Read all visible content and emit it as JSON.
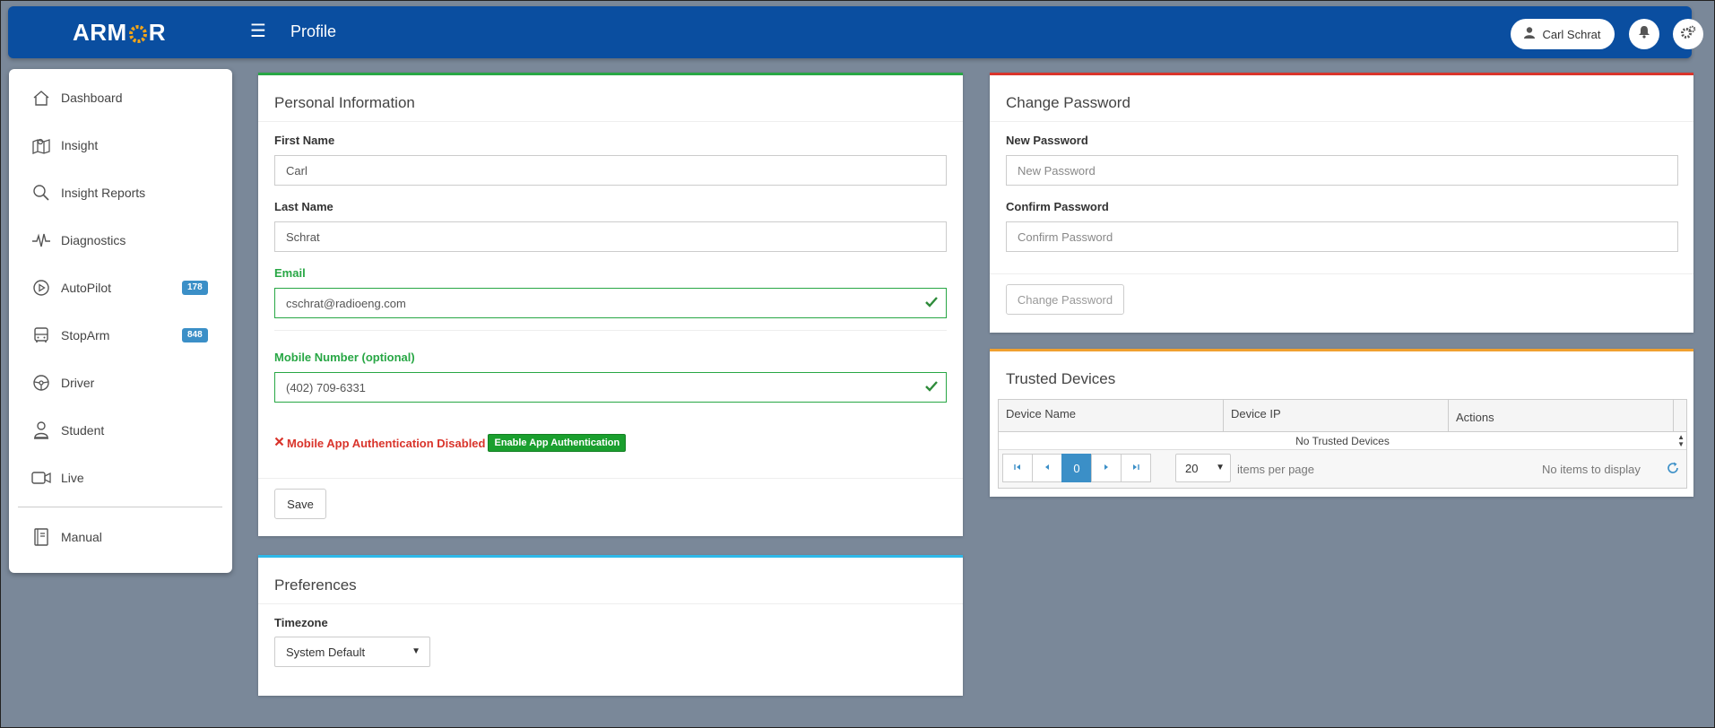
{
  "header": {
    "logo": "ARMOR",
    "page_title": "Profile",
    "user_name": "Carl Schrat"
  },
  "sidebar": {
    "items": [
      {
        "label": "Dashboard",
        "icon": "home-icon"
      },
      {
        "label": "Insight",
        "icon": "map-icon"
      },
      {
        "label": "Insight Reports",
        "icon": "search-icon"
      },
      {
        "label": "Diagnostics",
        "icon": "pulse-icon"
      },
      {
        "label": "AutoPilot",
        "icon": "play-circle-icon",
        "badge": "178"
      },
      {
        "label": "StopArm",
        "icon": "bus-icon",
        "badge": "848"
      },
      {
        "label": "Driver",
        "icon": "steering-wheel-icon"
      },
      {
        "label": "Student",
        "icon": "student-icon"
      },
      {
        "label": "Live",
        "icon": "video-camera-icon"
      },
      {
        "label": "Manual",
        "icon": "book-icon"
      }
    ]
  },
  "personal": {
    "title": "Personal Information",
    "first_name_label": "First Name",
    "first_name": "Carl",
    "last_name_label": "Last Name",
    "last_name": "Schrat",
    "email_label": "Email",
    "email": "cschrat@radioeng.com",
    "mobile_label": "Mobile Number (optional)",
    "mobile": "(402) 709-6331",
    "auth_status": "Mobile App Authentication Disabled",
    "auth_button": "Enable App Authentication",
    "save_label": "Save"
  },
  "preferences": {
    "title": "Preferences",
    "timezone_label": "Timezone",
    "timezone_value": "System Default"
  },
  "password": {
    "title": "Change Password",
    "new_label": "New Password",
    "new_placeholder": "New Password",
    "confirm_label": "Confirm Password",
    "confirm_placeholder": "Confirm Password",
    "button": "Change Password"
  },
  "devices": {
    "title": "Trusted Devices",
    "columns": [
      "Device Name",
      "Device IP",
      "Actions"
    ],
    "empty_text": "No Trusted Devices",
    "page": "0",
    "page_size": "20",
    "items_per_page": "items per page",
    "no_items": "No items to display"
  },
  "colors": {
    "header": "#0a4ea0",
    "personal_accent": "#28a745",
    "password_accent": "#d9342b",
    "devices_accent": "#f0a030",
    "preferences_accent": "#2fb8e8",
    "badge": "#3b8fc7"
  }
}
